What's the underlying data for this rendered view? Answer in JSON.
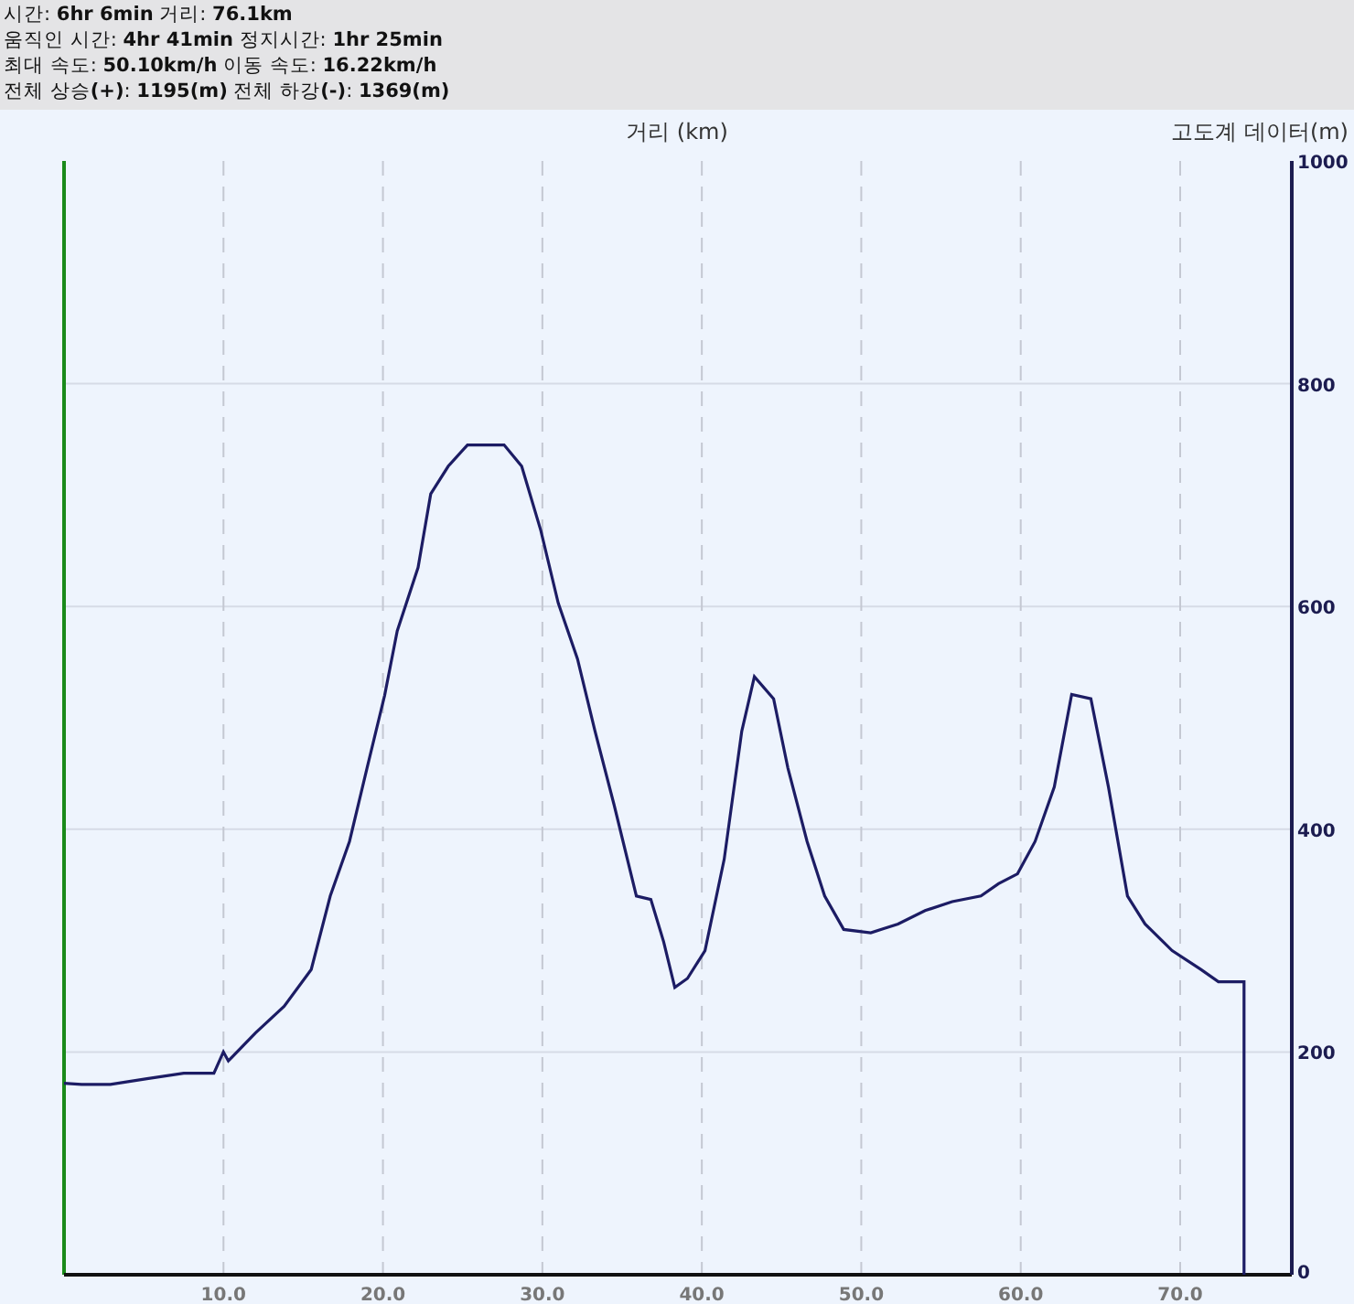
{
  "summary": [
    "시간: **6hr 6min**  거리: **76.1km**",
    "움직인 시간: **4hr 41min**  정지시간: **1hr 25min**",
    "최대 속도: **50.10km/h**  이동 속도: **16.22km/h**",
    "전체 상승**(+)**: **1195(m)**  전체 하강**(-)**: **1369(m)**"
  ],
  "chart": {
    "chart_data": {
      "type": "line",
      "grid": true,
      "xlabel": "거리 (km)",
      "ylabel": "고도계 데이터(m)",
      "xlim": [
        0,
        77
      ],
      "ylim": [
        0,
        1000
      ],
      "xticks": [
        {
          "value": 10,
          "label": "10.0"
        },
        {
          "value": 20,
          "label": "20.0"
        },
        {
          "value": 30,
          "label": "30.0"
        },
        {
          "value": 40,
          "label": "40.0"
        },
        {
          "value": 50,
          "label": "50.0"
        },
        {
          "value": 60,
          "label": "60.0"
        },
        {
          "value": 70,
          "label": "70.0"
        }
      ],
      "yticks": [
        0,
        200,
        400,
        600,
        800,
        1000
      ],
      "x": [
        0,
        1.1,
        2.9,
        5.2,
        7.5,
        9.4,
        10,
        10.3,
        12,
        13.8,
        15.5,
        16.7,
        17.9,
        19,
        20.1,
        20.9,
        22.2,
        23,
        24.1,
        25.3,
        26.4,
        27.6,
        28.7,
        29.9,
        31,
        32.2,
        33.3,
        34.5,
        35.9,
        36.8,
        37.6,
        38.3,
        39.1,
        40.2,
        41.4,
        42.5,
        43.3,
        44.5,
        45.4,
        46.6,
        47.7,
        48.9,
        50.6,
        52.3,
        54,
        55.7,
        57.5,
        58.6,
        59.8,
        60.9,
        62.1,
        63.2,
        64.4,
        65.5,
        66.7,
        67.8,
        69.5,
        71.3,
        72.4,
        74,
        74
      ],
      "series": [
        {
          "color": "#1c1c64",
          "values": [
            172,
            171,
            171,
            176,
            181,
            181,
            200,
            192,
            217,
            241,
            274,
            340,
            389,
            455,
            520,
            578,
            635,
            701,
            726,
            745,
            745,
            745,
            726,
            668,
            603,
            553,
            488,
            422,
            340,
            337,
            299,
            258,
            266,
            291,
            373,
            488,
            537,
            517,
            455,
            389,
            340,
            310,
            307,
            315,
            327,
            335,
            340,
            351,
            360,
            389,
            438,
            521,
            517,
            438,
            340,
            315,
            291,
            274,
            263,
            263,
            0
          ]
        }
      ]
    }
  }
}
